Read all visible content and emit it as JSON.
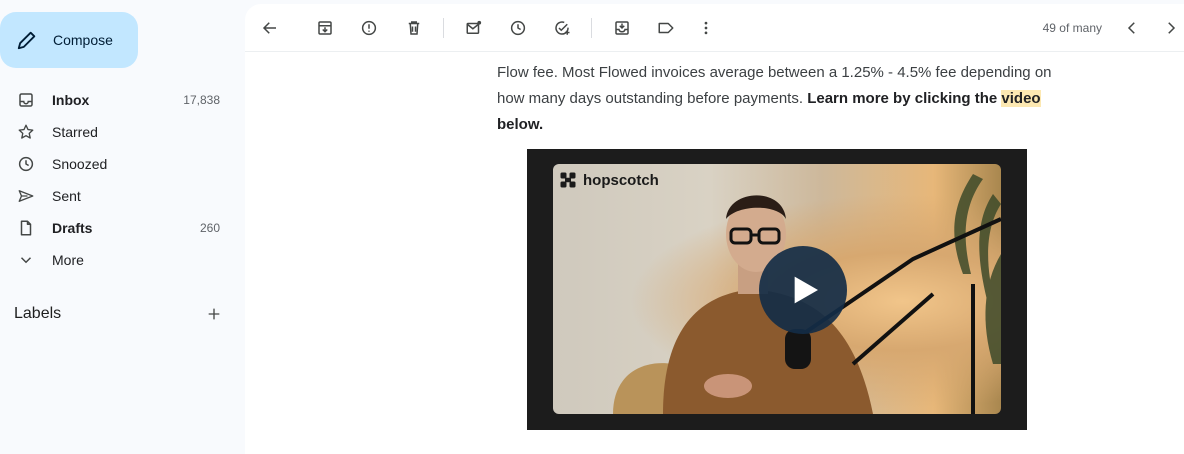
{
  "sidebar": {
    "compose_label": "Compose",
    "items": [
      {
        "label": "Inbox",
        "count": "17,838"
      },
      {
        "label": "Starred",
        "count": ""
      },
      {
        "label": "Snoozed",
        "count": ""
      },
      {
        "label": "Sent",
        "count": ""
      },
      {
        "label": "Drafts",
        "count": "260"
      },
      {
        "label": "More",
        "count": ""
      }
    ],
    "labels_title": "Labels"
  },
  "toolbar": {
    "pager_text": "49 of many",
    "icons": [
      "back-icon",
      "archive-icon",
      "report-spam-icon",
      "delete-icon",
      "mark-unread-icon",
      "snooze-icon",
      "add-task-icon",
      "move-to-icon",
      "label-icon",
      "more-icon",
      "prev-icon",
      "next-icon"
    ]
  },
  "email": {
    "line1": "Flow fee. Most Flowed invoices average between a 1.25% - 4.5% fee depending on",
    "line2_plain": "how many days outstanding before payments. ",
    "line2_bold": "Learn more by clicking the ",
    "line2_highlight": "video",
    "line3_bold": "below.",
    "video_brand": "hopscotch"
  },
  "colors": {
    "compose_bg": "#c2e7ff",
    "highlight": "#fce8b2",
    "play_button": "#142d46"
  }
}
